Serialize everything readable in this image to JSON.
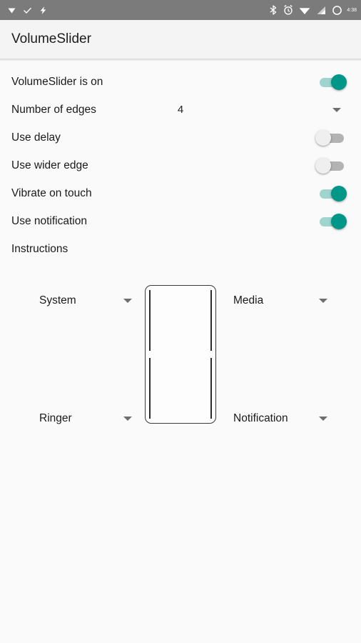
{
  "status_bar": {
    "background": "#7b7b7b",
    "left_icons": [
      {
        "name": "download-icon",
        "glyph": "▼"
      },
      {
        "name": "check-icon",
        "glyph": "✓"
      },
      {
        "name": "flash-icon",
        "glyph": "⚡"
      }
    ],
    "right_icons": [
      {
        "name": "bluetooth-icon"
      },
      {
        "name": "alarm-icon"
      },
      {
        "name": "wifi-icon"
      },
      {
        "name": "cellular-signal-icon"
      },
      {
        "name": "battery-icon"
      }
    ],
    "time": "4:38"
  },
  "action_bar": {
    "title": "VolumeSlider",
    "background": "#f4f4f4"
  },
  "theme": {
    "accent": "#009688",
    "track_on": "#9fd4cf",
    "track_off": "#b3b3b3",
    "thumb_off": "#efefef",
    "page_background": "#fafafa",
    "text_primary": "#1a1a1a"
  },
  "preferences": [
    {
      "title": "VolumeSlider is on",
      "control": "switch",
      "state": "on"
    },
    {
      "title": "Number of edges",
      "control": "dropdown",
      "value": "4"
    },
    {
      "title": "Use delay",
      "control": "switch",
      "state": "off"
    },
    {
      "title": "Use wider edge",
      "control": "switch",
      "state": "off"
    },
    {
      "title": "Vibrate on touch",
      "control": "switch",
      "state": "on"
    },
    {
      "title": "Use notification",
      "control": "switch",
      "state": "on"
    },
    {
      "title": "Instructions",
      "control": "none"
    }
  ],
  "edge_selectors": {
    "top_left": "System",
    "top_right": "Media",
    "bottom_left": "Ringer",
    "bottom_right": "Notification"
  },
  "phone_diagram": {
    "edge_count": 4,
    "outline_color": "#3a3a3a"
  }
}
